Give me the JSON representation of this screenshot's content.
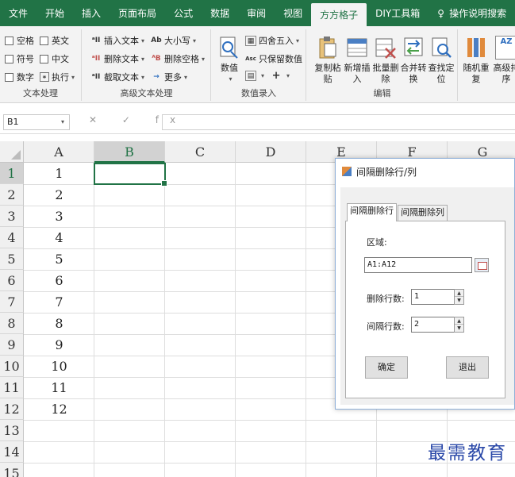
{
  "tabs": [
    "文件",
    "开始",
    "插入",
    "页面布局",
    "公式",
    "数据",
    "审阅",
    "视图",
    "方方格子",
    "DIY工具箱",
    "操作说明搜索"
  ],
  "active_tab": "方方格子",
  "ribbon": {
    "text_proc": {
      "label": "文本处理",
      "checks": [
        "空格",
        "英文",
        "符号",
        "中文",
        "数字"
      ],
      "exec": "执行"
    },
    "adv_text": {
      "label": "高级文本处理",
      "items": [
        "插入文本",
        "大小写",
        "删除文本",
        "删除空格",
        "截取文本",
        "更多"
      ],
      "icons": [
        "ᵃII",
        "Ab",
        "ᵃII",
        "ᴬB",
        "ᵃII",
        "→"
      ]
    },
    "num_entry": {
      "label": "数值录入",
      "value_btn": "数值",
      "round": "四舍五入",
      "keep": "只保留数值",
      "keep_icon": "Asc"
    },
    "edit": {
      "label": "编辑",
      "buttons": [
        "复制粘贴",
        "新增插入",
        "批量删除",
        "合并转换",
        "查找定位"
      ],
      "captions": [
        [
          "复制粘",
          "贴"
        ],
        [
          "新增插",
          "入"
        ],
        [
          "批量删",
          "除"
        ],
        [
          "合并转",
          "换"
        ],
        [
          "查找定",
          "位"
        ]
      ]
    },
    "more": {
      "buttons": [
        [
          "随机重",
          "复"
        ],
        [
          "高级排",
          "序"
        ]
      ],
      "sort_icon": "AZ"
    }
  },
  "formula_bar": {
    "name_box": "B1",
    "icons": "✕ ✓ fx",
    "formula": ""
  },
  "sheet": {
    "columns": [
      "A",
      "B",
      "C",
      "D",
      "E",
      "F",
      "G"
    ],
    "rows": [
      "1",
      "2",
      "3",
      "4",
      "5",
      "6",
      "7",
      "8",
      "9",
      "10",
      "11",
      "12",
      "13",
      "14",
      "15"
    ],
    "a_values": [
      "1",
      "2",
      "3",
      "4",
      "5",
      "6",
      "7",
      "8",
      "9",
      "10",
      "11",
      "12"
    ],
    "selected_col": "B",
    "selected_row": "1"
  },
  "dialog": {
    "title": "间隔删除行/列",
    "tabs": [
      "间隔删除行",
      "间隔删除列"
    ],
    "active_tab": "间隔删除行",
    "range_label": "区域:",
    "range_value": "A1:A12",
    "delete_rows_label": "删除行数:",
    "delete_rows_value": "1",
    "interval_label": "间隔行数:",
    "interval_value": "2",
    "ok": "确定",
    "exit": "退出"
  },
  "watermark": "最需教育",
  "colors": {
    "excel_green": "#217346",
    "dialog_border": "#8fb0d8",
    "watermark": "#2a48a8"
  }
}
